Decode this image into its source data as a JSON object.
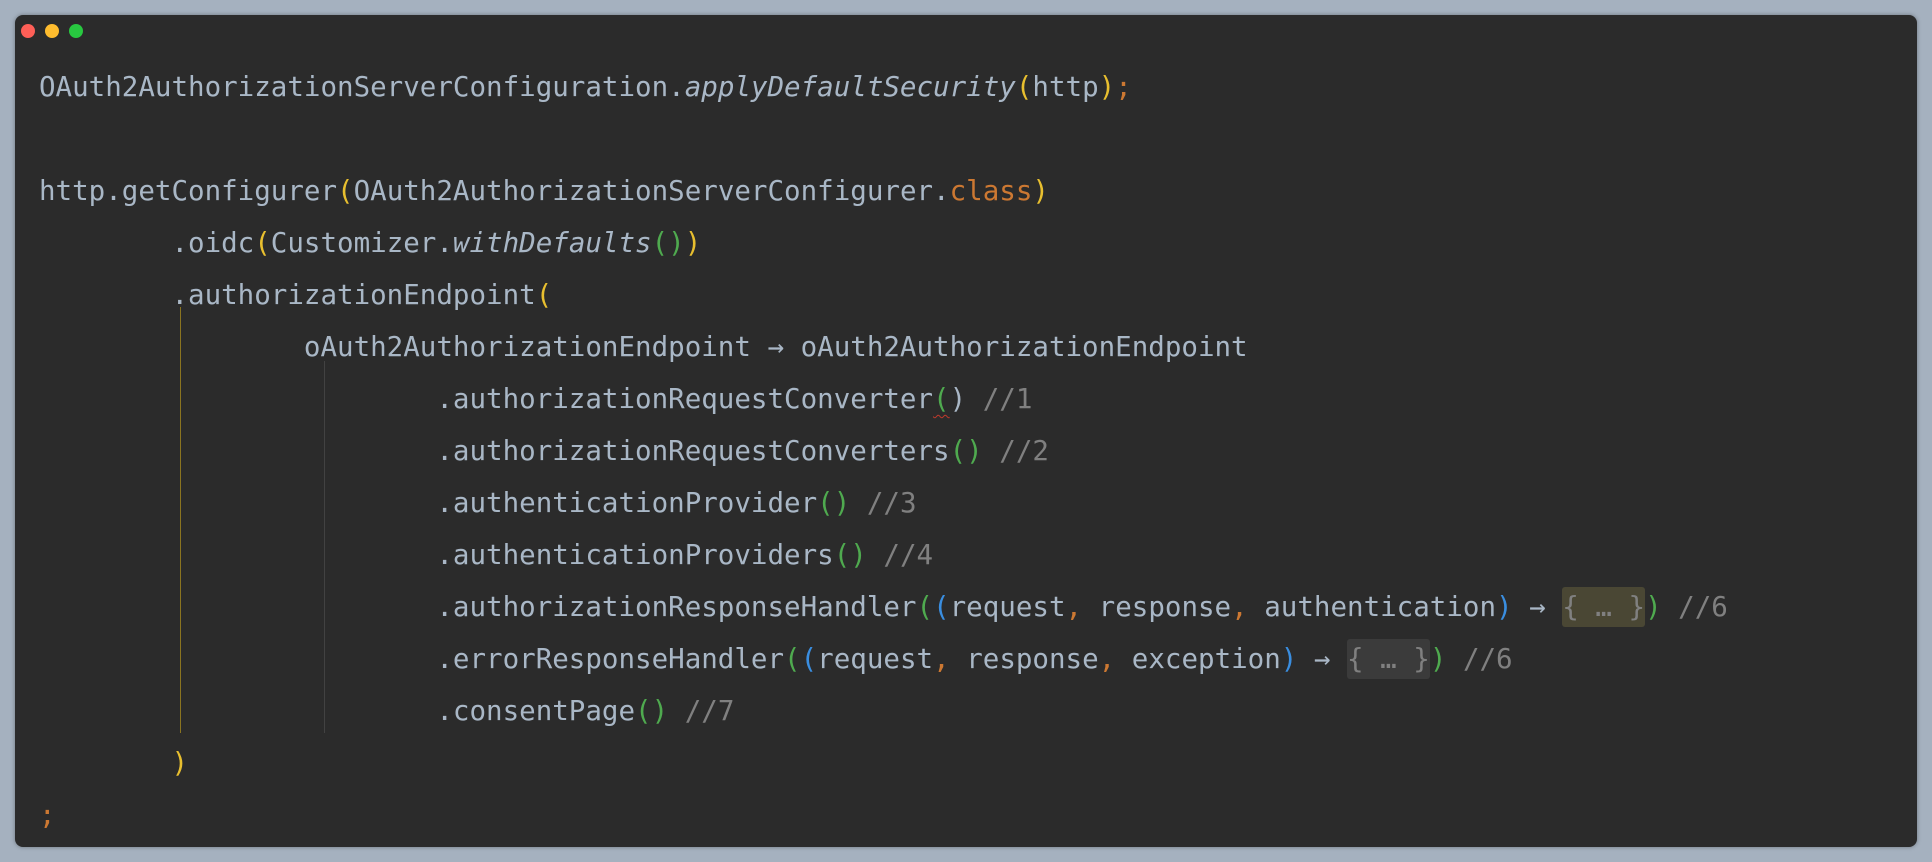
{
  "window": {
    "controls": [
      {
        "name": "close",
        "color": "#fe5f57"
      },
      {
        "name": "minimize",
        "color": "#febc2e"
      },
      {
        "name": "zoom",
        "color": "#28c840"
      }
    ]
  },
  "colors": {
    "background": "#2b2b2b",
    "text": "#a9b7c6",
    "keyword": "#cc7832",
    "paren_gold": "#e8bf2f",
    "paren_green": "#4faa4f",
    "paren_blue": "#3a8ee0",
    "comment": "#808080",
    "guide_gold": "#8a7420",
    "guide_gray": "#424242"
  },
  "code": {
    "lines": [
      [
        {
          "t": "OAuth2AuthorizationServerConfiguration.",
          "c": "text"
        },
        {
          "t": "applyDefaultSecurity",
          "c": "text",
          "italic": true
        },
        {
          "t": "(",
          "c": "paren_gold"
        },
        {
          "t": "http",
          "c": "text"
        },
        {
          "t": ")",
          "c": "paren_gold"
        },
        {
          "t": ";",
          "c": "keyword"
        }
      ],
      [],
      [
        {
          "t": "http.getConfigurer",
          "c": "text"
        },
        {
          "t": "(",
          "c": "paren_gold"
        },
        {
          "t": "OAuth2AuthorizationServerConfigurer.",
          "c": "text"
        },
        {
          "t": "class",
          "c": "keyword"
        },
        {
          "t": ")",
          "c": "paren_gold"
        }
      ],
      [
        {
          "t": "        .oidc",
          "c": "text"
        },
        {
          "t": "(",
          "c": "paren_gold"
        },
        {
          "t": "Customizer.",
          "c": "text"
        },
        {
          "t": "withDefaults",
          "c": "text",
          "italic": true
        },
        {
          "t": "()",
          "c": "paren_green"
        },
        {
          "t": ")",
          "c": "paren_gold"
        }
      ],
      [
        {
          "t": "        .authorizationEndpoint",
          "c": "text"
        },
        {
          "t": "(",
          "c": "paren_gold"
        }
      ],
      [
        {
          "t": "                oAuth2AuthorizationEndpoint → oAuth2AuthorizationEndpoint",
          "c": "text"
        }
      ],
      [
        {
          "t": "                        .authorizationRequestConverter",
          "c": "text"
        },
        {
          "t": "(",
          "c": "paren_green",
          "squiggle": true
        },
        {
          "t": ")",
          "c": "text"
        },
        {
          "t": " //1",
          "c": "comment"
        }
      ],
      [
        {
          "t": "                        .authorizationRequestConverters",
          "c": "text"
        },
        {
          "t": "()",
          "c": "paren_green"
        },
        {
          "t": " //2",
          "c": "comment"
        }
      ],
      [
        {
          "t": "                        .authenticationProvider",
          "c": "text"
        },
        {
          "t": "()",
          "c": "paren_green"
        },
        {
          "t": " //3",
          "c": "comment"
        }
      ],
      [
        {
          "t": "                        .authenticationProviders",
          "c": "text"
        },
        {
          "t": "()",
          "c": "paren_green"
        },
        {
          "t": " //4",
          "c": "comment"
        }
      ],
      [
        {
          "t": "                        .authorizationResponseHandler",
          "c": "text"
        },
        {
          "t": "(",
          "c": "paren_green"
        },
        {
          "t": "(",
          "c": "paren_blue"
        },
        {
          "t": "request",
          "c": "text"
        },
        {
          "t": ", ",
          "c": "keyword"
        },
        {
          "t": "response",
          "c": "text"
        },
        {
          "t": ", ",
          "c": "keyword"
        },
        {
          "t": "authentication",
          "c": "text"
        },
        {
          "t": ")",
          "c": "paren_blue"
        },
        {
          "t": " → ",
          "c": "text"
        },
        {
          "t": "{ … }",
          "c": "comment",
          "fold": "highlight"
        },
        {
          "t": ")",
          "c": "paren_green"
        },
        {
          "t": " //6",
          "c": "comment"
        }
      ],
      [
        {
          "t": "                        .errorResponseHandler",
          "c": "text"
        },
        {
          "t": "(",
          "c": "paren_green"
        },
        {
          "t": "(",
          "c": "paren_blue"
        },
        {
          "t": "request",
          "c": "text"
        },
        {
          "t": ", ",
          "c": "keyword"
        },
        {
          "t": "response",
          "c": "text"
        },
        {
          "t": ", ",
          "c": "keyword"
        },
        {
          "t": "exception",
          "c": "text"
        },
        {
          "t": ")",
          "c": "paren_blue"
        },
        {
          "t": " → ",
          "c": "text"
        },
        {
          "t": "{ … }",
          "c": "comment",
          "fold": "plain"
        },
        {
          "t": ")",
          "c": "paren_green"
        },
        {
          "t": " //6",
          "c": "comment"
        }
      ],
      [
        {
          "t": "                        .consentPage",
          "c": "text"
        },
        {
          "t": "()",
          "c": "paren_green"
        },
        {
          "t": " //7",
          "c": "comment"
        }
      ],
      [
        {
          "t": "        ",
          "c": "text"
        },
        {
          "t": ")",
          "c": "paren_gold"
        }
      ],
      [
        {
          "t": ";",
          "c": "keyword"
        }
      ]
    ]
  }
}
